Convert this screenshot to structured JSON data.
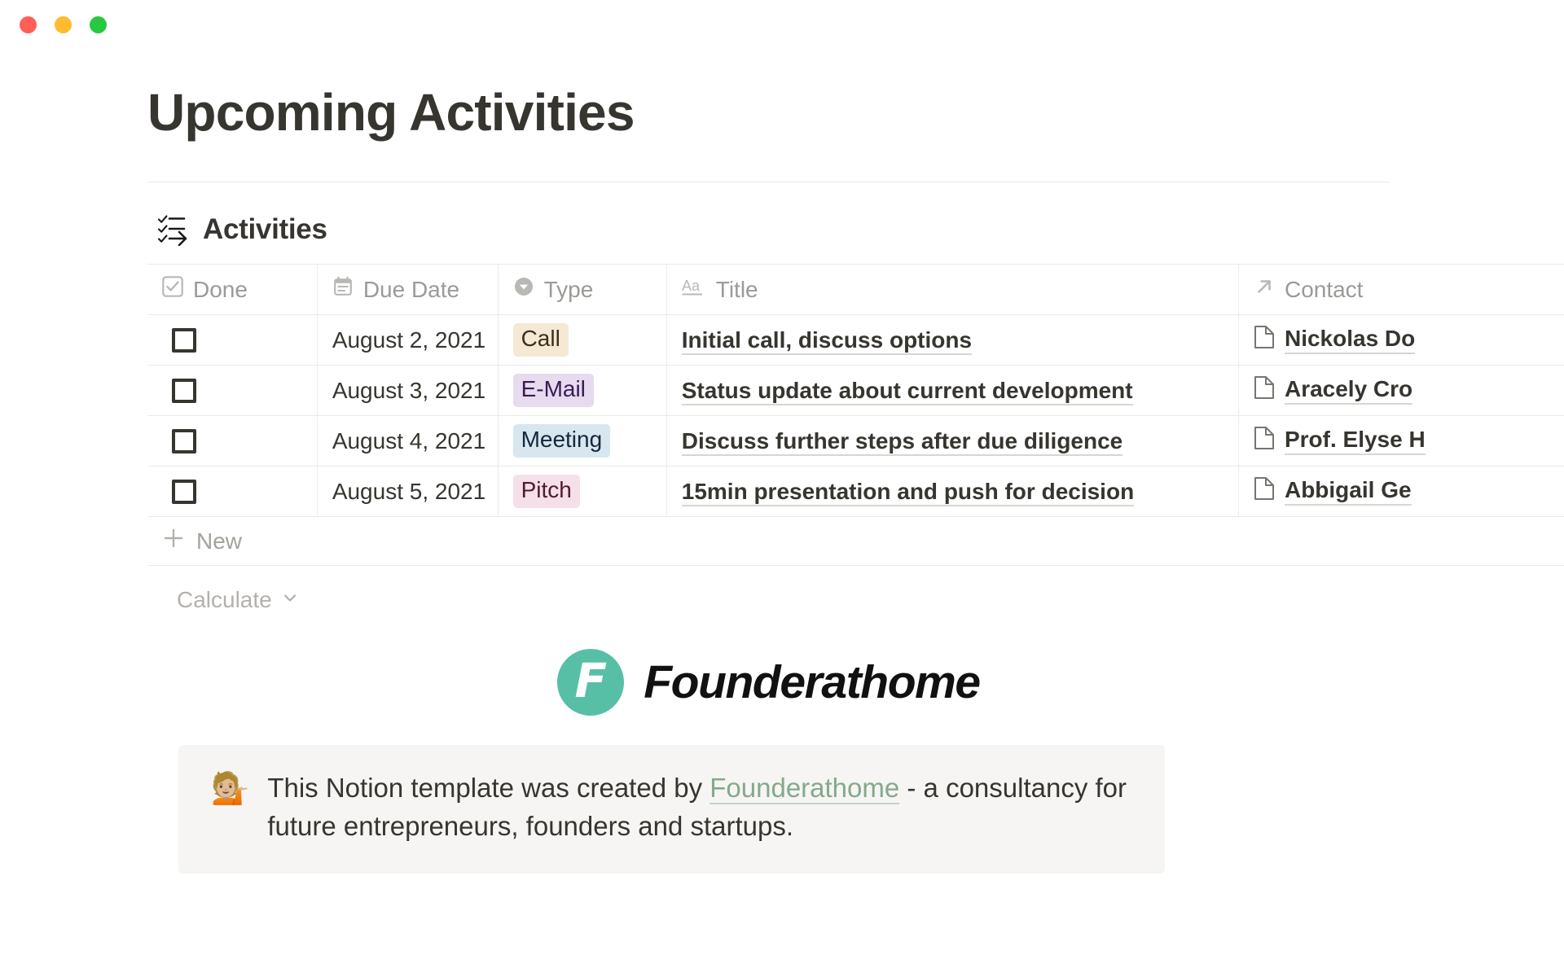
{
  "window": {
    "close_label": "close",
    "minimize_label": "minimize",
    "maximize_label": "maximize",
    "colors": {
      "close": "#ff5f57",
      "minimize": "#febc2e",
      "maximize": "#28c840"
    }
  },
  "page": {
    "title": "Upcoming Activities"
  },
  "database": {
    "icon": "checklist-arrow-icon",
    "name": "Activities",
    "columns": [
      {
        "label": "Done",
        "icon": "checkbox-icon"
      },
      {
        "label": "Due Date",
        "icon": "calendar-icon"
      },
      {
        "label": "Type",
        "icon": "select-icon"
      },
      {
        "label": "Title",
        "icon": "text-aa-icon"
      },
      {
        "label": "Contact",
        "icon": "relation-arrow-icon"
      }
    ],
    "rows": [
      {
        "done": false,
        "due_date": "August 2, 2021",
        "type": "Call",
        "type_style": "call",
        "title": "Initial call, discuss options",
        "contact": "Nickolas Do"
      },
      {
        "done": false,
        "due_date": "August 3, 2021",
        "type": "E-Mail",
        "type_style": "email",
        "title": "Status update about current development",
        "contact": "Aracely Cro"
      },
      {
        "done": false,
        "due_date": "August 4, 2021",
        "type": "Meeting",
        "type_style": "meeting",
        "title": "Discuss further steps after due diligence",
        "contact": "Prof. Elyse H"
      },
      {
        "done": false,
        "due_date": "August 5, 2021",
        "type": "Pitch",
        "type_style": "pitch",
        "title": "15min presentation and push for decision",
        "contact": "Abbigail Ge"
      }
    ],
    "new_row_label": "New",
    "calculate_label": "Calculate",
    "tag_colors": {
      "call": {
        "bg": "#f5e9d3",
        "fg": "#3c2f1b"
      },
      "email": {
        "bg": "#e6dbef",
        "fg": "#3b1b57"
      },
      "meeting": {
        "bg": "#d7e6ef",
        "fg": "#16263c"
      },
      "pitch": {
        "bg": "#f5e0e9",
        "fg": "#55182e"
      }
    }
  },
  "logo": {
    "mark_letter": "F",
    "mark_color": "#58bfa7",
    "wordmark": "Founderathome"
  },
  "callout": {
    "emoji": "💁🏼",
    "text_before": "This Notion template was created by ",
    "link_text": "Founderathome",
    "text_after": " - a consultancy for future entrepreneurs, founders and startups.",
    "link_color": "#84a98c",
    "background": "#f6f5f3"
  }
}
